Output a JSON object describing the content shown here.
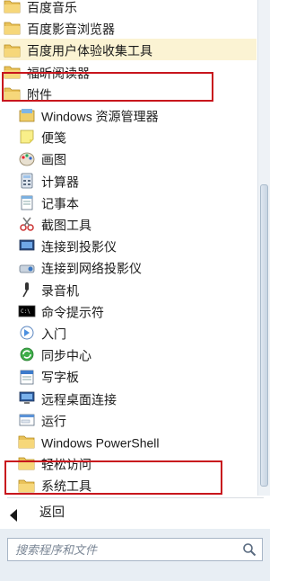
{
  "items": [
    {
      "label": "百度音乐",
      "kind": "folder",
      "icon": "folder-icon"
    },
    {
      "label": "百度影音浏览器",
      "kind": "folder",
      "icon": "folder-icon"
    },
    {
      "label": "百度用户体验收集工具",
      "kind": "folder",
      "icon": "folder-icon",
      "highlighted": true
    },
    {
      "label": "福昕阅读器",
      "kind": "folder",
      "icon": "folder-icon"
    },
    {
      "label": "附件",
      "kind": "folder",
      "icon": "folder-icon",
      "expanded": true
    },
    {
      "label": "Windows 资源管理器",
      "kind": "app",
      "icon": "explorer-icon"
    },
    {
      "label": "便笺",
      "kind": "app",
      "icon": "sticky-notes-icon"
    },
    {
      "label": "画图",
      "kind": "app",
      "icon": "paint-icon"
    },
    {
      "label": "计算器",
      "kind": "app",
      "icon": "calculator-icon"
    },
    {
      "label": "记事本",
      "kind": "app",
      "icon": "notepad-icon"
    },
    {
      "label": "截图工具",
      "kind": "app",
      "icon": "snipping-tool-icon"
    },
    {
      "label": "连接到投影仪",
      "kind": "app",
      "icon": "projector-icon"
    },
    {
      "label": "连接到网络投影仪",
      "kind": "app",
      "icon": "network-projector-icon"
    },
    {
      "label": "录音机",
      "kind": "app",
      "icon": "microphone-icon"
    },
    {
      "label": "命令提示符",
      "kind": "app",
      "icon": "command-prompt-icon"
    },
    {
      "label": "入门",
      "kind": "app",
      "icon": "getting-started-icon"
    },
    {
      "label": "同步中心",
      "kind": "app",
      "icon": "sync-center-icon"
    },
    {
      "label": "写字板",
      "kind": "app",
      "icon": "wordpad-icon"
    },
    {
      "label": "远程桌面连接",
      "kind": "app",
      "icon": "remote-desktop-icon"
    },
    {
      "label": "运行",
      "kind": "app",
      "icon": "run-icon"
    },
    {
      "label": "Windows PowerShell",
      "kind": "folder-sub",
      "icon": "folder-icon"
    },
    {
      "label": "轻松访问",
      "kind": "folder-sub",
      "icon": "folder-icon"
    },
    {
      "label": "系统工具",
      "kind": "folder-sub",
      "icon": "folder-icon"
    }
  ],
  "back_label": "返回",
  "search": {
    "placeholder": "搜索程序和文件"
  },
  "colors": {
    "highlight": "#fbf3d3",
    "annotation_box": "#c8161d",
    "search_bar_bg": "#e8eef4"
  }
}
